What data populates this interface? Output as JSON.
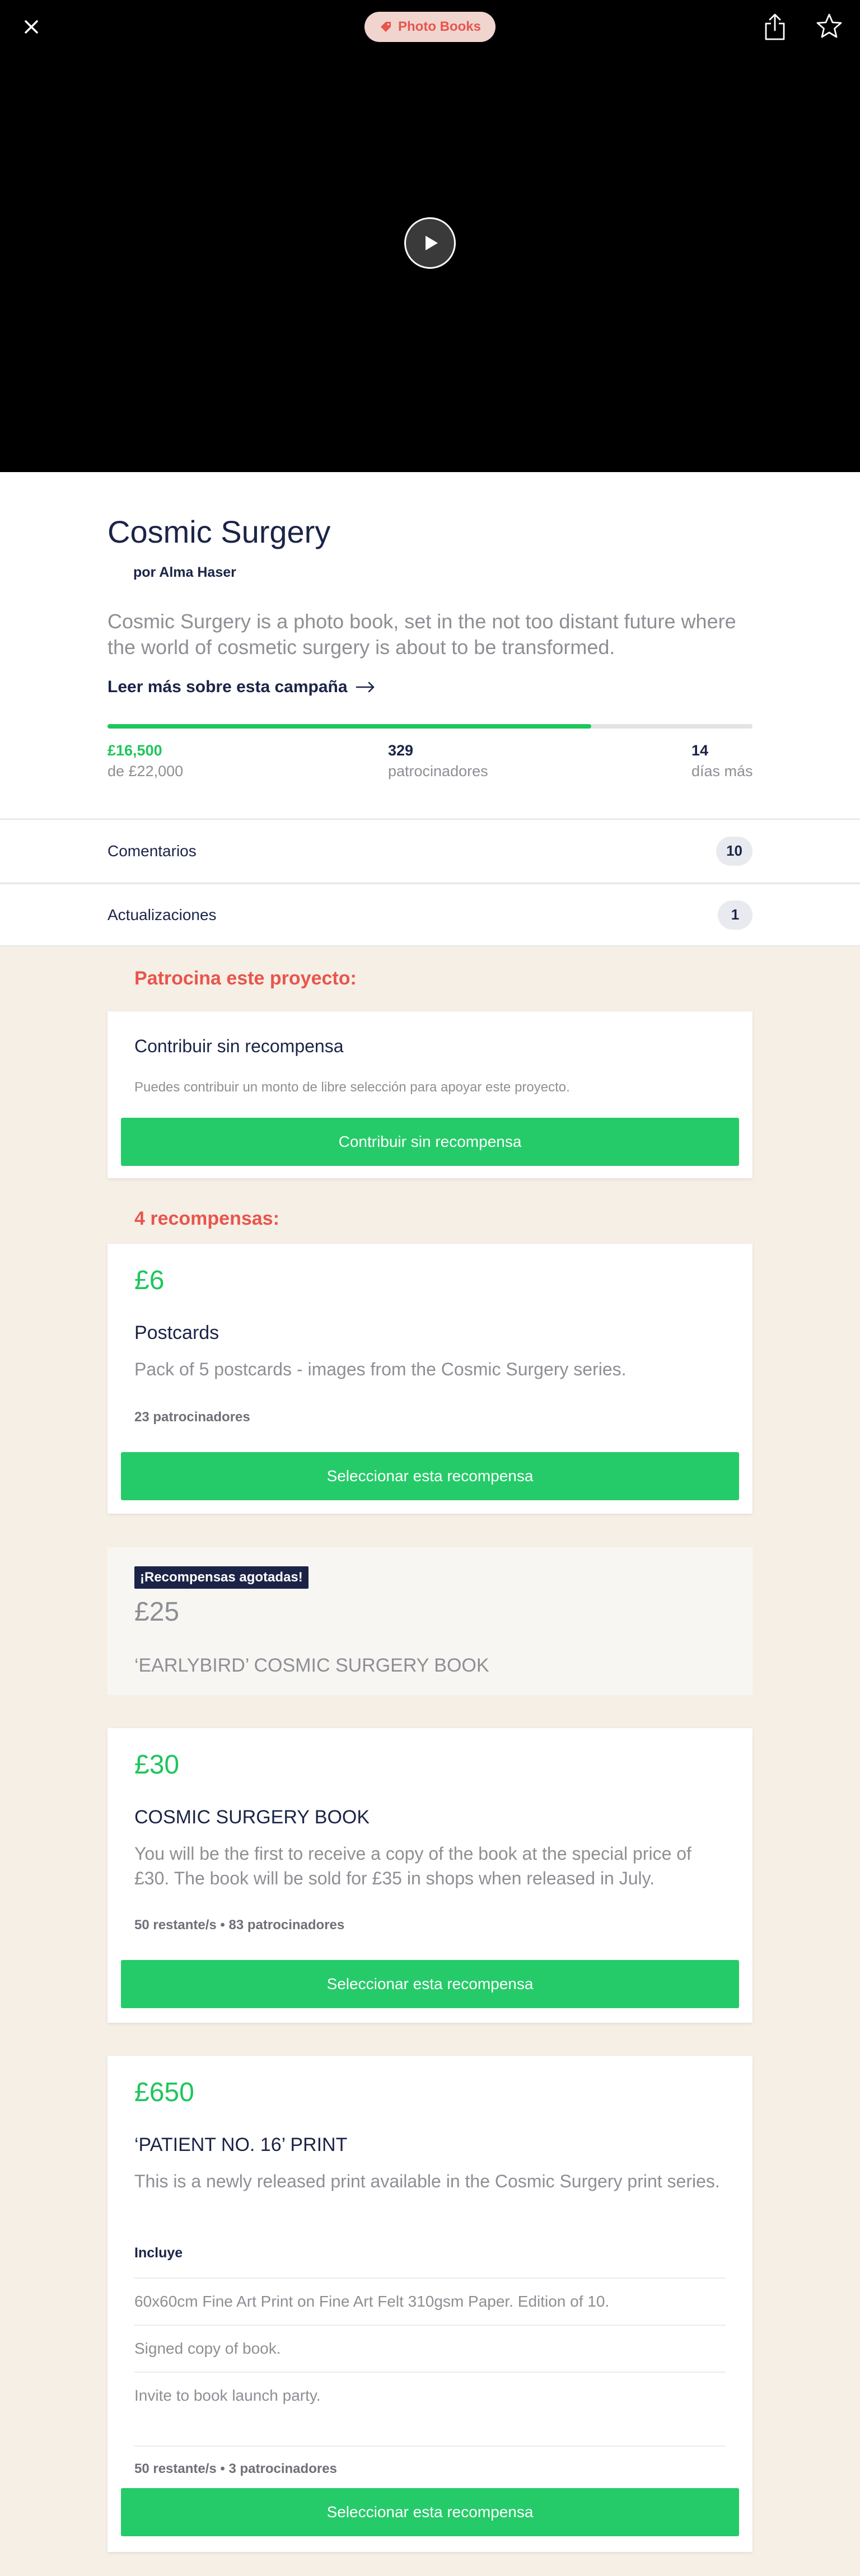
{
  "header": {
    "category": "Photo Books"
  },
  "project": {
    "title": "Cosmic Surgery",
    "creator": "por Alma Haser",
    "blurb": "Cosmic Surgery is a photo book, set in the not too distant future where the world of cosmetic surgery is about to be transformed.",
    "read_more": "Leer más sobre esta campaña",
    "progress_fraction": 0.75,
    "pledged": "£16,500",
    "goal": "de £22,000",
    "backers_count": "329",
    "backers_label": "patrocinadores",
    "days_count": "14",
    "days_label": "días más"
  },
  "rows": {
    "comments_label": "Comentarios",
    "comments_count": "10",
    "updates_label": "Actualizaciones",
    "updates_count": "1"
  },
  "back_project": {
    "heading": "Patrocina este proyecto:",
    "no_reward_title": "Contribuir sin recompensa",
    "no_reward_desc": "Puedes contribuir un monto de libre selección para apoyar este proyecto.",
    "no_reward_button": "Contribuir sin recompensa"
  },
  "rewards": {
    "heading": "4 recompensas:",
    "select_label": "Seleccionar esta recompensa",
    "r1": {
      "price": "£6",
      "title": "Postcards",
      "desc": "Pack of 5 postcards - images from the Cosmic Surgery series.",
      "meta": "23 patrocinadores"
    },
    "r2": {
      "badge": "¡Recompensas agotadas!",
      "price": "£25",
      "title": "‘EARLYBIRD’ COSMIC SURGERY BOOK"
    },
    "r3": {
      "price": "£30",
      "title": "COSMIC SURGERY BOOK",
      "desc": "You will be the first to receive a copy of the book at the special price of £30. The book will be sold for £35 in shops when released in July.",
      "meta": "50 restante/s • 83 patrocinadores"
    },
    "r4": {
      "price": "£650",
      "title": "‘PATIENT NO. 16’ PRINT",
      "desc": "This is a newly released print available in the Cosmic Surgery print series.",
      "includes_label": "Incluye",
      "includes": [
        "60x60cm Fine Art Print on Fine Art Felt 310gsm Paper. Edition of 10.",
        "Signed copy of book.",
        "Invite to book launch party."
      ],
      "meta": "50 restante/s • 3 patrocinadores"
    }
  },
  "colors": {
    "accent_green": "#1ec65c",
    "button_green": "#25cb68",
    "heading_red": "#e8554d",
    "navy": "#1b2447",
    "background": "#f6efe5"
  },
  "icons": [
    "close-icon",
    "tag-icon",
    "share-icon",
    "star-icon",
    "play-icon",
    "arrow-right-icon"
  ]
}
